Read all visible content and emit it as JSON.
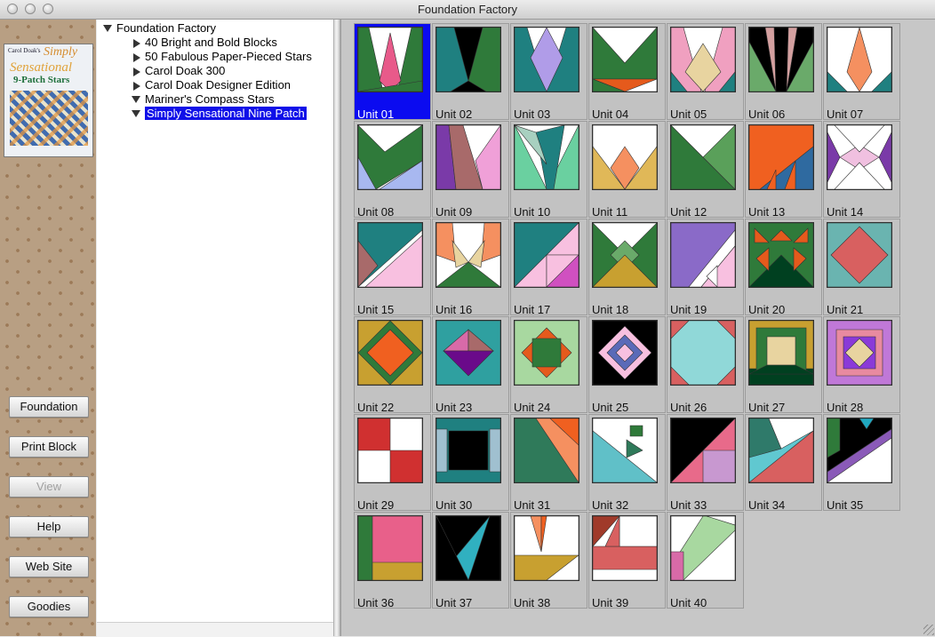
{
  "window": {
    "title": "Foundation Factory"
  },
  "book_cover": {
    "line1": "Carol Doak's",
    "line2": "Simply",
    "line3": "Sensational",
    "line4": "9-Patch Stars"
  },
  "sidebar": {
    "buttons": [
      {
        "label": "Foundation",
        "enabled": true
      },
      {
        "label": "Print Block",
        "enabled": true
      },
      {
        "label": "View",
        "enabled": false
      },
      {
        "label": "Help",
        "enabled": true
      },
      {
        "label": "Web Site",
        "enabled": true
      },
      {
        "label": "Goodies",
        "enabled": true
      }
    ]
  },
  "tree": {
    "root": "Foundation Factory",
    "items": [
      {
        "label": "40 Bright and Bold Blocks",
        "expanded": false,
        "selected": false
      },
      {
        "label": "50 Fabulous Paper-Pieced Stars",
        "expanded": false,
        "selected": false
      },
      {
        "label": "Carol Doak 300",
        "expanded": false,
        "selected": false
      },
      {
        "label": "Carol Doak Designer Edition",
        "expanded": false,
        "selected": false
      },
      {
        "label": "Mariner's Compass Stars",
        "expanded": true,
        "selected": false
      },
      {
        "label": "Simply Sensational Nine Patch",
        "expanded": true,
        "selected": true
      }
    ]
  },
  "colors": {
    "selection": "#1010e8",
    "grid_bg": "#c7c7c7",
    "cell_bg": "#c2c2c2"
  },
  "units": [
    {
      "label": "Unit 01",
      "selected": true
    },
    {
      "label": "Unit 02"
    },
    {
      "label": "Unit 03"
    },
    {
      "label": "Unit 04"
    },
    {
      "label": "Unit 05"
    },
    {
      "label": "Unit 06"
    },
    {
      "label": "Unit 07"
    },
    {
      "label": "Unit 08"
    },
    {
      "label": "Unit 09"
    },
    {
      "label": "Unit 10"
    },
    {
      "label": "Unit 11"
    },
    {
      "label": "Unit 12"
    },
    {
      "label": "Unit 13"
    },
    {
      "label": "Unit 14"
    },
    {
      "label": "Unit 15"
    },
    {
      "label": "Unit 16"
    },
    {
      "label": "Unit 17"
    },
    {
      "label": "Unit 18"
    },
    {
      "label": "Unit 19"
    },
    {
      "label": "Unit 20"
    },
    {
      "label": "Unit 21"
    },
    {
      "label": "Unit 22"
    },
    {
      "label": "Unit 23"
    },
    {
      "label": "Unit 24"
    },
    {
      "label": "Unit 25"
    },
    {
      "label": "Unit 26"
    },
    {
      "label": "Unit 27"
    },
    {
      "label": "Unit 28"
    },
    {
      "label": "Unit 29"
    },
    {
      "label": "Unit 30"
    },
    {
      "label": "Unit 31"
    },
    {
      "label": "Unit 32"
    },
    {
      "label": "Unit 33"
    },
    {
      "label": "Unit 34"
    },
    {
      "label": "Unit 35"
    },
    {
      "label": "Unit 36"
    },
    {
      "label": "Unit 37"
    },
    {
      "label": "Unit 38"
    },
    {
      "label": "Unit 39"
    },
    {
      "label": "Unit 40"
    }
  ]
}
